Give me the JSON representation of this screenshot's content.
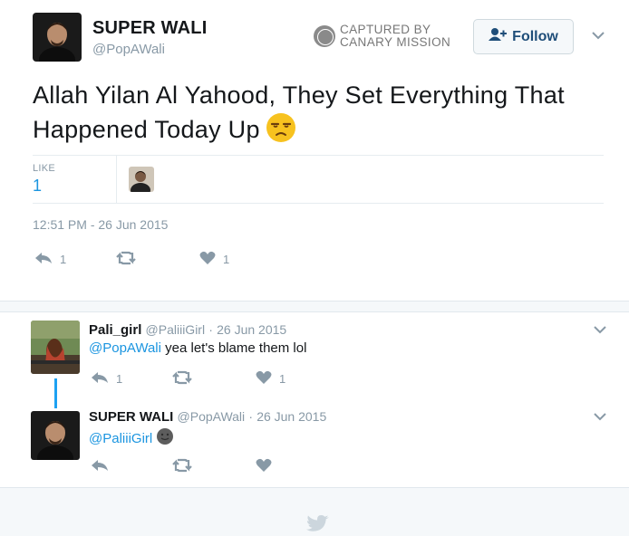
{
  "tweet": {
    "author_name": "SUPER WALI",
    "author_handle": "@PopAWali",
    "text": "Allah Yilan Al Yahood, They Set Everything That Happened Today Up",
    "emoji": "unamused-face",
    "like_label": "LIKE",
    "like_count": "1",
    "timestamp": "12:51 PM - 26 Jun 2015",
    "reply_count": "1",
    "like_action_count": "1"
  },
  "watermark": {
    "line1": "CAPTURED BY",
    "line2": "CANARY MISSION"
  },
  "follow_button": {
    "label": "Follow"
  },
  "replies": [
    {
      "name": "Pali_girl",
      "handle": "@PaliiiGirl",
      "separator": "·",
      "date": "26 Jun 2015",
      "mention": "@PopAWali",
      "text": " yea let's blame them lol",
      "reply_count": "1",
      "like_count": "1"
    },
    {
      "name": "SUPER WALI",
      "handle": "@PopAWali",
      "separator": "·",
      "date": "26 Jun 2015",
      "mention": "@PaliiiGirl",
      "emoji": "dark-smiley-face"
    }
  ],
  "colors": {
    "link": "#1b95e0",
    "muted": "#8899a6",
    "thread_line": "#1da1f2",
    "follow_text": "#1f4e79"
  },
  "icons": [
    "person-add-icon",
    "chevron-down-icon",
    "reply-icon",
    "retweet-icon",
    "heart-icon",
    "twitter-bird-icon"
  ]
}
